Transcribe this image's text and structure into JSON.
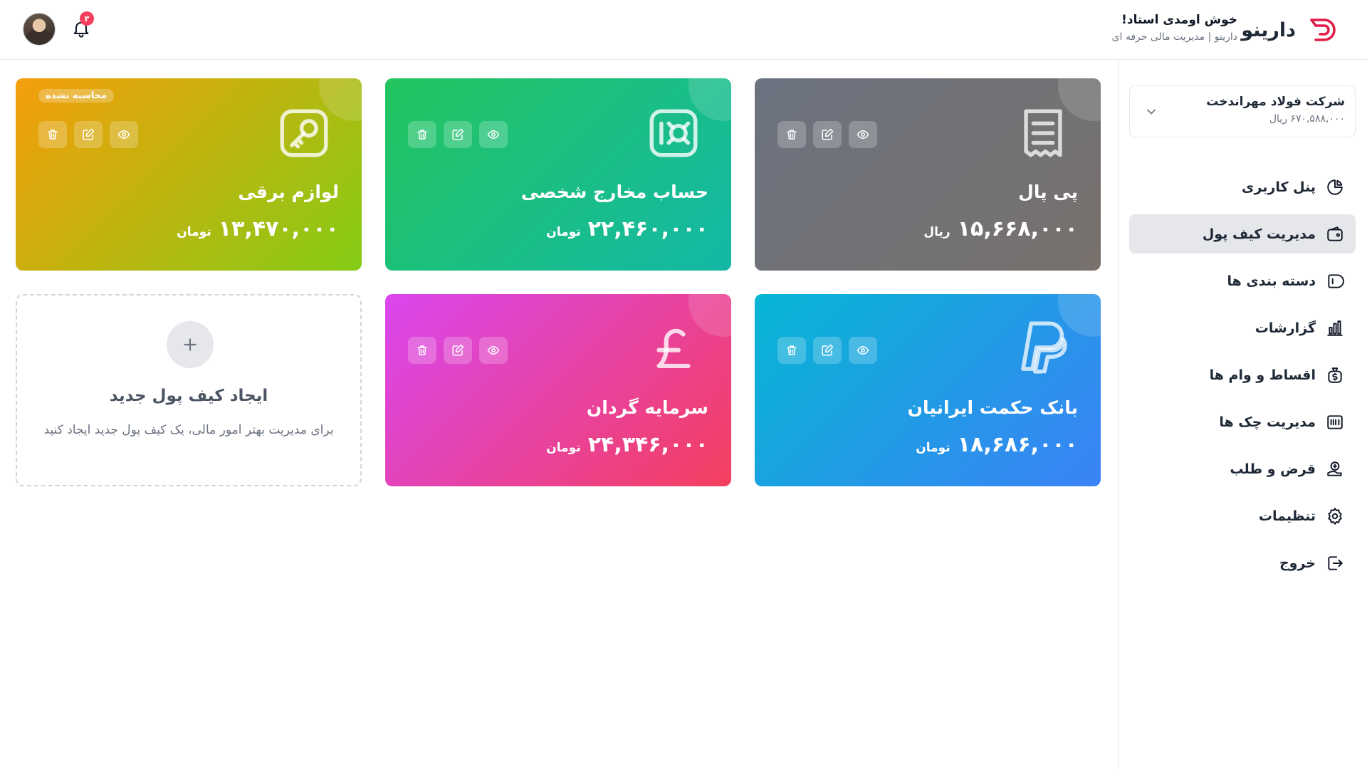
{
  "header": {
    "brand_name": "دارینو",
    "welcome_title": "خوش اومدی استاد!",
    "welcome_subtitle": "دارینو | مدیریت مالی حرفه ای",
    "notification_count": "۳",
    "brand_color": "#e11d48"
  },
  "sidebar": {
    "company": {
      "name": "شرکت فولاد مهراندخت",
      "balance": "۶۷۰,۵۸۸,۰۰۰ ریال"
    },
    "items": [
      {
        "label": "پنل کاربری",
        "icon": "pie-chart-icon",
        "active": false
      },
      {
        "label": "مدیریت کیف پول",
        "icon": "wallet-icon",
        "active": true
      },
      {
        "label": "دسته بندی ها",
        "icon": "tag-icon",
        "active": false
      },
      {
        "label": "گزارشات",
        "icon": "bar-chart-icon",
        "active": false
      },
      {
        "label": "اقساط و وام ها",
        "icon": "money-bag-icon",
        "active": false
      },
      {
        "label": "مدیریت چک ها",
        "icon": "check-icon",
        "active": false
      },
      {
        "label": "قرض و طلب",
        "icon": "loan-icon",
        "active": false
      },
      {
        "label": "تنظیمات",
        "icon": "gear-icon",
        "active": false
      },
      {
        "label": "خروج",
        "icon": "logout-icon",
        "active": false
      }
    ]
  },
  "wallets": [
    {
      "title": "پی پال",
      "amount": "۱۵,۶۶۸,۰۰۰",
      "currency": "ریال",
      "icon": "receipt-icon",
      "gradient": [
        "#6b7280",
        "#78716c"
      ]
    },
    {
      "title": "حساب مخارج شخصی",
      "amount": "۲۲,۴۶۰,۰۰۰",
      "currency": "تومان",
      "icon": "safe-icon",
      "gradient": [
        "#22c55e",
        "#14b8a6"
      ]
    },
    {
      "title": "لوازم برقی",
      "amount": "۱۳,۴۷۰,۰۰۰",
      "currency": "تومان",
      "icon": "key-icon",
      "badge": "محاسبه نشده",
      "gradient": [
        "#f59e0b",
        "#84cc16"
      ]
    },
    {
      "title": "بانک حکمت ایرانیان",
      "amount": "۱۸,۶۸۶,۰۰۰",
      "currency": "تومان",
      "icon": "paypal-icon",
      "gradient": [
        "#06b6d4",
        "#3b82f6"
      ]
    },
    {
      "title": "سرمایه گردان",
      "amount": "۲۴,۳۴۶,۰۰۰",
      "currency": "تومان",
      "icon": "pound-icon",
      "gradient": [
        "#d946ef",
        "#f43f5e"
      ]
    }
  ],
  "add_wallet": {
    "title": "ایجاد کیف پول جدید",
    "description": "برای مدیریت بهتر امور مالی، یک کیف پول جدید ایجاد کنید"
  }
}
